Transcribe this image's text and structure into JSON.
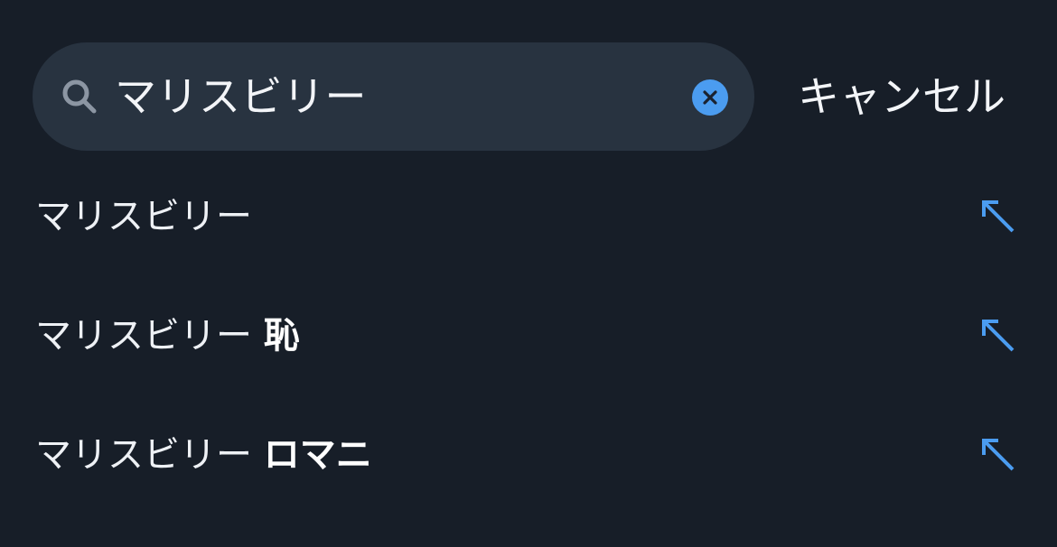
{
  "search": {
    "query": "マリスビリー",
    "search_icon": "magnifier-icon",
    "clear_icon": "clear-x-icon",
    "cancel_label": "キャンセル"
  },
  "suggestions": [
    {
      "prefix": "マリスビリー",
      "completion": "",
      "icon": "fill-arrow-icon"
    },
    {
      "prefix": "マリスビリー",
      "completion": "恥",
      "icon": "fill-arrow-icon"
    },
    {
      "prefix": "マリスビリー",
      "completion": "ロマニ",
      "icon": "fill-arrow-icon"
    }
  ],
  "colors": {
    "background": "#171e28",
    "search_field": "#283340",
    "accent": "#4b9cf0",
    "text": "#eef1f5"
  }
}
